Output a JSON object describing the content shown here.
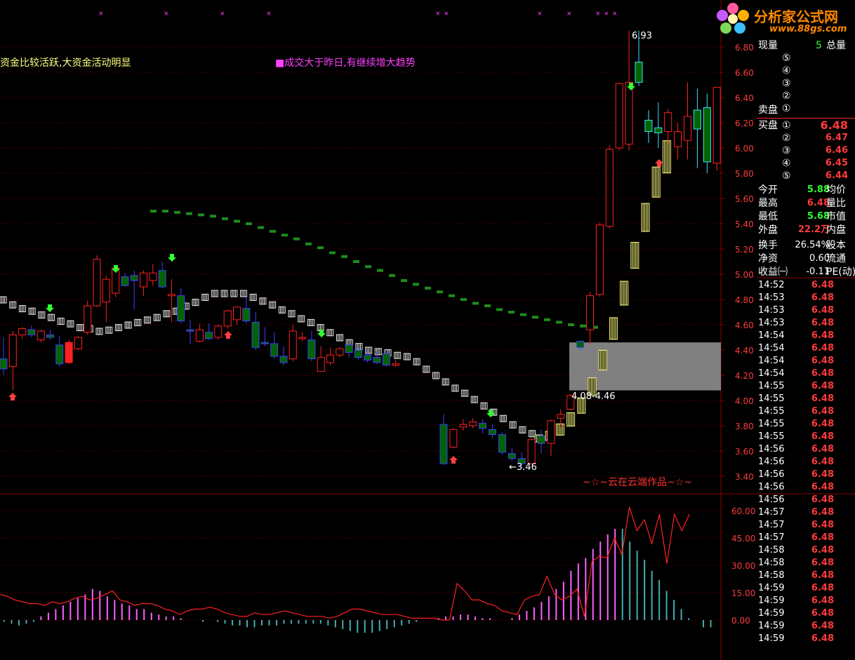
{
  "colors": {
    "background": "#000000",
    "grid": "#8b0000",
    "up": "#ff2020",
    "down_fill": "#006400",
    "down_edge": "#4040ff",
    "annotation_yellow": "#ffff80",
    "annotation_magenta": "#ff40ff",
    "logo_orange": "#ff8800",
    "green_text": "#30ff30",
    "red_text": "#ff3b3b"
  },
  "logo": {
    "title": "分析家公式网",
    "url": "www.88gs.com"
  },
  "annotations": {
    "left": "资金比较活跃,大资金活动明显",
    "center": "■成交大于昨日,有继续增大趋势",
    "signature": "~☆~云在云端作品~☆~",
    "high_label": "6.93",
    "low_label": "←3.46",
    "box_label": "4.08-4.46"
  },
  "chart_data": [
    {
      "type": "candlestick",
      "title": "",
      "y_axis_ticks": [
        "6.80",
        "6.60",
        "6.40",
        "6.20",
        "6.00",
        "5.80",
        "5.60",
        "5.40",
        "5.20",
        "5.00",
        "4.80",
        "4.60",
        "4.40",
        "4.20",
        "4.00",
        "3.80",
        "3.60",
        "3.40"
      ],
      "ylim": [
        3.3,
        6.95
      ],
      "high": 6.93,
      "low": 3.46,
      "zone": [
        4.08,
        4.46
      ],
      "candles": [
        {
          "o": 4.33,
          "h": 4.5,
          "c": 4.25,
          "l": 4.2
        },
        {
          "o": 4.27,
          "h": 4.55,
          "c": 4.52,
          "l": 4.08
        },
        {
          "o": 4.52,
          "h": 4.58,
          "c": 4.57,
          "l": 4.49
        },
        {
          "o": 4.56,
          "h": 4.59,
          "c": 4.52,
          "l": 4.5
        },
        {
          "o": 4.48,
          "h": 4.56,
          "c": 4.55,
          "l": 4.46
        },
        {
          "o": 4.52,
          "h": 4.56,
          "c": 4.5,
          "l": 4.48
        },
        {
          "o": 4.44,
          "h": 4.51,
          "c": 4.29,
          "l": 4.27
        },
        {
          "o": 4.3,
          "h": 4.48,
          "c": 4.46,
          "l": 4.29
        },
        {
          "o": 4.41,
          "h": 4.51,
          "c": 4.5,
          "l": 4.4
        },
        {
          "o": 4.54,
          "h": 4.79,
          "c": 4.75,
          "l": 4.52
        },
        {
          "o": 4.75,
          "h": 5.15,
          "c": 5.12,
          "l": 4.74
        },
        {
          "o": 4.78,
          "h": 4.99,
          "c": 4.96,
          "l": 4.62
        },
        {
          "o": 4.85,
          "h": 5.05,
          "c": 5.05,
          "l": 4.82
        },
        {
          "o": 4.98,
          "h": 5.01,
          "c": 4.91,
          "l": 4.9
        },
        {
          "o": 4.99,
          "h": 5.03,
          "c": 4.95,
          "l": 4.72
        },
        {
          "o": 4.9,
          "h": 5.03,
          "c": 5.01,
          "l": 4.83
        },
        {
          "o": 4.95,
          "h": 5.08,
          "c": 5.01,
          "l": 4.91
        },
        {
          "o": 5.03,
          "h": 5.1,
          "c": 4.9,
          "l": 4.89
        },
        {
          "o": 4.83,
          "h": 4.96,
          "c": 4.84,
          "l": 4.62
        },
        {
          "o": 4.83,
          "h": 4.89,
          "c": 4.63,
          "l": 4.61
        },
        {
          "o": 4.56,
          "h": 4.64,
          "c": 4.55,
          "l": 4.45
        },
        {
          "o": 4.47,
          "h": 4.61,
          "c": 4.56,
          "l": 4.46
        },
        {
          "o": 4.54,
          "h": 4.61,
          "c": 4.49,
          "l": 4.48
        },
        {
          "o": 4.5,
          "h": 4.6,
          "c": 4.59,
          "l": 4.48
        },
        {
          "o": 4.59,
          "h": 4.72,
          "c": 4.71,
          "l": 4.57
        },
        {
          "o": 4.64,
          "h": 4.74,
          "c": 4.74,
          "l": 4.6
        },
        {
          "o": 4.73,
          "h": 4.82,
          "c": 4.63,
          "l": 4.61
        },
        {
          "o": 4.62,
          "h": 4.7,
          "c": 4.42,
          "l": 4.4
        },
        {
          "o": 4.46,
          "h": 4.58,
          "c": 4.45,
          "l": 4.43
        },
        {
          "o": 4.45,
          "h": 4.54,
          "c": 4.35,
          "l": 4.33
        },
        {
          "o": 4.35,
          "h": 4.43,
          "c": 4.3,
          "l": 4.28
        },
        {
          "o": 4.33,
          "h": 4.6,
          "c": 4.55,
          "l": 4.31
        },
        {
          "o": 4.49,
          "h": 4.54,
          "c": 4.5,
          "l": 4.47
        },
        {
          "o": 4.48,
          "h": 4.55,
          "c": 4.33,
          "l": 4.31
        },
        {
          "o": 4.23,
          "h": 4.43,
          "c": 4.34,
          "l": 4.23
        },
        {
          "o": 4.3,
          "h": 4.42,
          "c": 4.36,
          "l": 4.28
        },
        {
          "o": 4.36,
          "h": 4.42,
          "c": 4.41,
          "l": 4.34
        },
        {
          "o": 4.44,
          "h": 4.46,
          "c": 4.38,
          "l": 4.34
        },
        {
          "o": 4.4,
          "h": 4.42,
          "c": 4.34,
          "l": 4.32
        },
        {
          "o": 4.36,
          "h": 4.4,
          "c": 4.32,
          "l": 4.3
        },
        {
          "o": 4.34,
          "h": 4.38,
          "c": 4.3,
          "l": 4.29
        },
        {
          "o": 4.37,
          "h": 4.4,
          "c": 4.28,
          "l": 4.27
        },
        {
          "o": 4.29,
          "h": 4.32,
          "c": 4.29,
          "l": 4.27
        },
        {
          "o": 3.81,
          "h": 3.89,
          "c": 3.5,
          "l": 3.49
        },
        {
          "o": 3.63,
          "h": 3.78,
          "c": 3.77,
          "l": 3.62
        },
        {
          "o": 3.79,
          "h": 3.85,
          "c": 3.81,
          "l": 3.76
        },
        {
          "o": 3.8,
          "h": 3.86,
          "c": 3.83,
          "l": 3.78
        },
        {
          "o": 3.82,
          "h": 3.85,
          "c": 3.78,
          "l": 3.74
        },
        {
          "o": 3.77,
          "h": 3.81,
          "c": 3.73,
          "l": 3.7
        },
        {
          "o": 3.73,
          "h": 3.75,
          "c": 3.59,
          "l": 3.57
        },
        {
          "o": 3.58,
          "h": 3.62,
          "c": 3.54,
          "l": 3.52
        },
        {
          "o": 3.54,
          "h": 3.59,
          "c": 3.5,
          "l": 3.46
        },
        {
          "o": 3.5,
          "h": 3.7,
          "c": 3.69,
          "l": 3.49
        },
        {
          "o": 3.72,
          "h": 3.77,
          "c": 3.66,
          "l": 3.58
        },
        {
          "o": 3.66,
          "h": 3.85,
          "c": 3.84,
          "l": 3.56
        },
        {
          "o": 3.86,
          "h": 3.93,
          "c": 3.89,
          "l": 3.79
        },
        {
          "o": 3.93,
          "h": 4.05,
          "c": 4.04,
          "l": 3.92
        },
        {
          "o": 4.47,
          "h": 4.47,
          "c": 4.42,
          "l": 4.4
        },
        {
          "o": 4.56,
          "h": 4.86,
          "c": 4.83,
          "l": 4.44
        },
        {
          "o": 4.84,
          "h": 5.41,
          "c": 5.39,
          "l": 4.82
        },
        {
          "o": 5.38,
          "h": 6.02,
          "c": 5.99,
          "l": 5.36
        },
        {
          "o": 6.0,
          "h": 6.52,
          "c": 6.51,
          "l": 5.98
        },
        {
          "o": 6.03,
          "h": 6.93,
          "c": 6.52,
          "l": 5.98
        },
        {
          "o": 6.68,
          "h": 6.93,
          "c": 6.52,
          "l": 6.49
        },
        {
          "o": 6.22,
          "h": 6.3,
          "c": 6.13,
          "l": 6.04
        },
        {
          "o": 6.16,
          "h": 6.36,
          "c": 6.12,
          "l": 6.0
        },
        {
          "o": 6.13,
          "h": 6.31,
          "c": 6.28,
          "l": 6.03
        },
        {
          "o": 6.01,
          "h": 6.2,
          "c": 6.13,
          "l": 5.91
        },
        {
          "o": 6.06,
          "h": 6.52,
          "c": 6.25,
          "l": 5.91
        },
        {
          "o": 6.3,
          "h": 6.47,
          "c": 6.15,
          "l": 5.84
        },
        {
          "o": 6.32,
          "h": 6.43,
          "c": 5.89,
          "l": 5.8
        },
        {
          "o": 5.88,
          "h": 6.48,
          "c": 6.48,
          "l": 5.82
        }
      ],
      "avg_line_white": [
        4.8,
        4.76,
        4.73,
        4.71,
        4.68,
        4.66,
        4.63,
        4.61,
        4.58,
        4.57,
        4.55,
        4.56,
        4.58,
        4.6,
        4.62,
        4.64,
        4.66,
        4.69,
        4.71,
        4.75,
        4.78,
        4.82,
        4.85,
        4.85,
        4.85,
        4.85,
        4.82,
        4.79,
        4.76,
        4.72,
        4.69,
        4.65,
        4.62,
        4.58,
        4.54,
        4.5,
        4.46,
        4.43,
        4.4,
        4.39,
        4.38,
        4.36,
        4.35,
        4.31,
        4.25,
        4.2,
        4.15,
        4.1,
        4.06,
        4.01,
        3.96,
        3.91,
        3.86,
        3.81,
        3.77,
        3.74
      ],
      "avg_line_yellow": [
        3.7,
        3.72,
        3.77,
        3.85,
        3.96,
        4.11,
        4.32,
        4.57,
        4.85,
        5.15,
        5.45,
        5.73,
        5.93
      ],
      "ma_green": [
        5.5,
        5.5,
        5.49,
        5.48,
        5.47,
        5.46,
        5.44,
        5.42,
        5.4,
        5.37,
        5.34,
        5.31,
        5.28,
        5.24,
        5.21,
        5.17,
        5.14,
        5.1,
        5.06,
        5.03,
        4.99,
        4.95,
        4.92,
        4.89,
        4.86,
        4.83,
        4.8,
        4.77,
        4.75,
        4.72,
        4.7,
        4.68,
        4.66,
        4.64,
        4.62,
        4.6,
        4.59,
        4.58
      ]
    },
    {
      "type": "line",
      "title": "",
      "y_axis_ticks": [
        "60.00",
        "45.00",
        "30.00",
        "15.00",
        "0.00"
      ],
      "ylim": [
        -5,
        67
      ],
      "line": [
        14,
        13,
        11,
        10,
        9,
        9,
        8,
        10,
        9,
        10,
        12,
        13,
        11,
        12,
        14,
        16,
        11,
        10,
        8,
        9,
        9,
        8,
        6,
        5,
        3,
        5,
        6,
        6,
        7,
        6,
        4,
        3,
        2,
        2,
        4,
        3,
        3,
        4,
        5,
        4,
        3,
        2,
        2,
        2,
        1,
        2,
        4,
        6,
        6,
        5,
        4,
        3,
        3,
        3,
        2,
        1,
        1,
        1,
        1,
        0,
        0,
        20,
        16,
        11,
        11,
        9,
        8,
        5,
        4,
        3,
        11,
        13,
        14,
        24,
        14,
        11,
        13,
        17,
        2,
        32,
        35,
        34,
        45,
        36,
        62,
        49,
        55,
        42,
        58,
        31,
        58,
        49,
        58
      ],
      "bars": [
        -1,
        -2,
        -3,
        -2,
        -1,
        2,
        4,
        6,
        8,
        10,
        12,
        14,
        17,
        16,
        13,
        11,
        9,
        8,
        6,
        6,
        4,
        3,
        2,
        2,
        1,
        0,
        0,
        -1,
        0,
        -1,
        -2,
        -3,
        -3,
        -4,
        -4,
        -3,
        -3,
        -3,
        -2,
        -2,
        -2,
        -2,
        -2,
        -2,
        -3,
        -4,
        -5,
        -6,
        -7,
        -7,
        -7,
        -6,
        -5,
        -4,
        -3,
        -2,
        -1,
        0,
        0,
        1,
        2,
        2,
        3,
        3,
        2,
        1,
        1,
        0,
        0,
        1,
        3,
        5,
        7,
        10,
        13,
        17,
        21,
        27,
        31,
        34,
        39,
        43,
        47,
        50,
        50,
        43,
        38,
        33,
        27,
        22,
        16,
        11,
        6,
        1,
        0,
        -4,
        -4
      ]
    }
  ],
  "quote": {
    "xianliang_label": "现量",
    "xianliang_value": "5",
    "zongliang_label": "总量",
    "sell_levels": [
      "⑤",
      "④",
      "③",
      "②",
      "①"
    ],
    "sell_label": "卖盘",
    "buy_label": "买盘",
    "buy_levels": [
      {
        "lv": "①",
        "price": "6.48"
      },
      {
        "lv": "②",
        "price": "6.47"
      },
      {
        "lv": "③",
        "price": "6.46"
      },
      {
        "lv": "④",
        "price": "6.45"
      },
      {
        "lv": "⑤",
        "price": "6.44"
      }
    ],
    "stats": [
      {
        "k": "今开",
        "v": "5.88",
        "k2": "均价",
        "vc": "#30ff30"
      },
      {
        "k": "最高",
        "v": "6.48",
        "k2": "量比",
        "vc": "#ff3b3b"
      },
      {
        "k": "最低",
        "v": "5.68",
        "k2": "市值",
        "vc": "#30ff30"
      },
      {
        "k": "外盘",
        "v": "22.2万",
        "k2": "内盘",
        "vc": "#ff3b3b"
      }
    ],
    "stats2": [
      {
        "k": "换手",
        "v": "26.54%",
        "k2": "股本",
        "vc": "#ffffff"
      },
      {
        "k": "净资",
        "v": "0.60",
        "k2": "流通",
        "vc": "#ffffff"
      },
      {
        "k": "收益㈠",
        "v": "-0.11",
        "k2": "PE(动)",
        "vc": "#ffffff"
      }
    ],
    "trades": [
      {
        "t": "14:52",
        "p": "6.48"
      },
      {
        "t": "14:53",
        "p": "6.48"
      },
      {
        "t": "14:53",
        "p": "6.48"
      },
      {
        "t": "14:53",
        "p": "6.48"
      },
      {
        "t": "14:54",
        "p": "6.48"
      },
      {
        "t": "14:54",
        "p": "6.48"
      },
      {
        "t": "14:54",
        "p": "6.48"
      },
      {
        "t": "14:54",
        "p": "6.48"
      },
      {
        "t": "14:55",
        "p": "6.48"
      },
      {
        "t": "14:55",
        "p": "6.48"
      },
      {
        "t": "14:55",
        "p": "6.48"
      },
      {
        "t": "14:55",
        "p": "6.48"
      },
      {
        "t": "14:55",
        "p": "6.48"
      },
      {
        "t": "14:56",
        "p": "6.48"
      },
      {
        "t": "14:56",
        "p": "6.48"
      },
      {
        "t": "14:56",
        "p": "6.48"
      },
      {
        "t": "14:56",
        "p": "6.48"
      },
      {
        "t": "14:56",
        "p": "6.48"
      },
      {
        "t": "14:57",
        "p": "6.48"
      },
      {
        "t": "14:57",
        "p": "6.48"
      },
      {
        "t": "14:57",
        "p": "6.48"
      },
      {
        "t": "14:58",
        "p": "6.48"
      },
      {
        "t": "14:58",
        "p": "6.48"
      },
      {
        "t": "14:58",
        "p": "6.48"
      },
      {
        "t": "14:59",
        "p": "6.48"
      },
      {
        "t": "14:59",
        "p": "6.48"
      },
      {
        "t": "14:59",
        "p": "6.48"
      },
      {
        "t": "14:59",
        "p": "6.48"
      },
      {
        "t": "14:59",
        "p": "6.48"
      }
    ]
  }
}
